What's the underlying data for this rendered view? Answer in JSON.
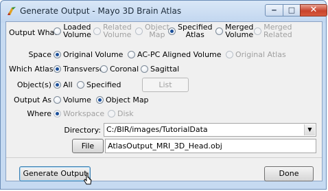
{
  "window": {
    "title": "Generate Output - Mayo 3D Brain Atlas",
    "minimize_glyph": "‒",
    "maximize_glyph": "□",
    "close_glyph": "✕"
  },
  "form": {
    "output_what": {
      "label": "Output What",
      "options": [
        {
          "line1": "Loaded",
          "line2": "Volume",
          "selected": false,
          "enabled": true
        },
        {
          "line1": "Related",
          "line2": "Volume",
          "selected": false,
          "enabled": false
        },
        {
          "line1": "Object",
          "line2": "Map",
          "selected": false,
          "enabled": false
        },
        {
          "line1": "Specified",
          "line2": "Atlas",
          "selected": true,
          "enabled": true
        },
        {
          "line1": "Merged",
          "line2": "Volume",
          "selected": false,
          "enabled": true
        },
        {
          "line1": "Merged",
          "line2": "Related",
          "selected": false,
          "enabled": false
        }
      ]
    },
    "space": {
      "label": "Space",
      "options": [
        {
          "text": "Original Volume",
          "selected": true,
          "enabled": true
        },
        {
          "text": "AC-PC Aligned Volume",
          "selected": false,
          "enabled": true
        },
        {
          "text": "Original Atlas",
          "selected": false,
          "enabled": false
        }
      ]
    },
    "which_atlas": {
      "label": "Which Atlas",
      "options": [
        {
          "text": "Transverse",
          "selected": true,
          "enabled": true
        },
        {
          "text": "Coronal",
          "selected": false,
          "enabled": true
        },
        {
          "text": "Sagittal",
          "selected": false,
          "enabled": true
        }
      ]
    },
    "objects": {
      "label": "Object(s)",
      "options": [
        {
          "text": "All",
          "selected": true,
          "enabled": true
        },
        {
          "text": "Specified",
          "selected": false,
          "enabled": true
        }
      ],
      "list_button": "List"
    },
    "output_as": {
      "label": "Output As",
      "options": [
        {
          "text": "Volume",
          "selected": false,
          "enabled": true
        },
        {
          "text": "Object Map",
          "selected": true,
          "enabled": true
        }
      ]
    },
    "where": {
      "label": "Where",
      "options": [
        {
          "text": "Workspace",
          "selected": true,
          "enabled": false
        },
        {
          "text": "Disk",
          "selected": false,
          "enabled": false
        }
      ]
    },
    "directory": {
      "label": "Directory:",
      "value": "C:/BIR/images/TutorialData",
      "dropdown_glyph": "▼"
    },
    "file": {
      "button": "File",
      "value": "AtlasOutput_MRI_3D_Head.obj"
    }
  },
  "footer": {
    "generate_button": "Generate Output",
    "done_button": "Done"
  }
}
